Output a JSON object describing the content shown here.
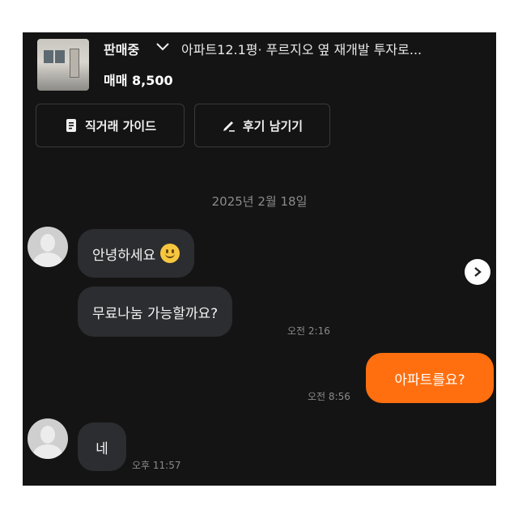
{
  "colors": {
    "background": "#141414",
    "accent": "#ff6f0f",
    "bubble_other": "#2c2d30",
    "muted": "#8b8b8b"
  },
  "listing": {
    "status": "판매중",
    "title": "아파트12.1평· 푸르지오 옆 재개발 투자로...",
    "price": "매매 8,500"
  },
  "actions": {
    "guide_label": "직거래 가이드",
    "review_label": "후기 남기기"
  },
  "chat": {
    "date": "2025년 2월 18일",
    "messages": [
      {
        "sender": "other",
        "text": "안녕하세요",
        "emoji": "slightly-smiling-face"
      },
      {
        "sender": "other",
        "text": "무료나눔 가능할까요?",
        "time": "오전 2:16"
      },
      {
        "sender": "me",
        "text": "아파트를요?",
        "time": "오전 8:56"
      },
      {
        "sender": "other",
        "text": "네",
        "time": "오후 11:57"
      }
    ]
  },
  "icons": [
    "chevron-down-icon",
    "document-icon",
    "pencil-icon",
    "avatar-icon",
    "next-arrow-icon"
  ]
}
